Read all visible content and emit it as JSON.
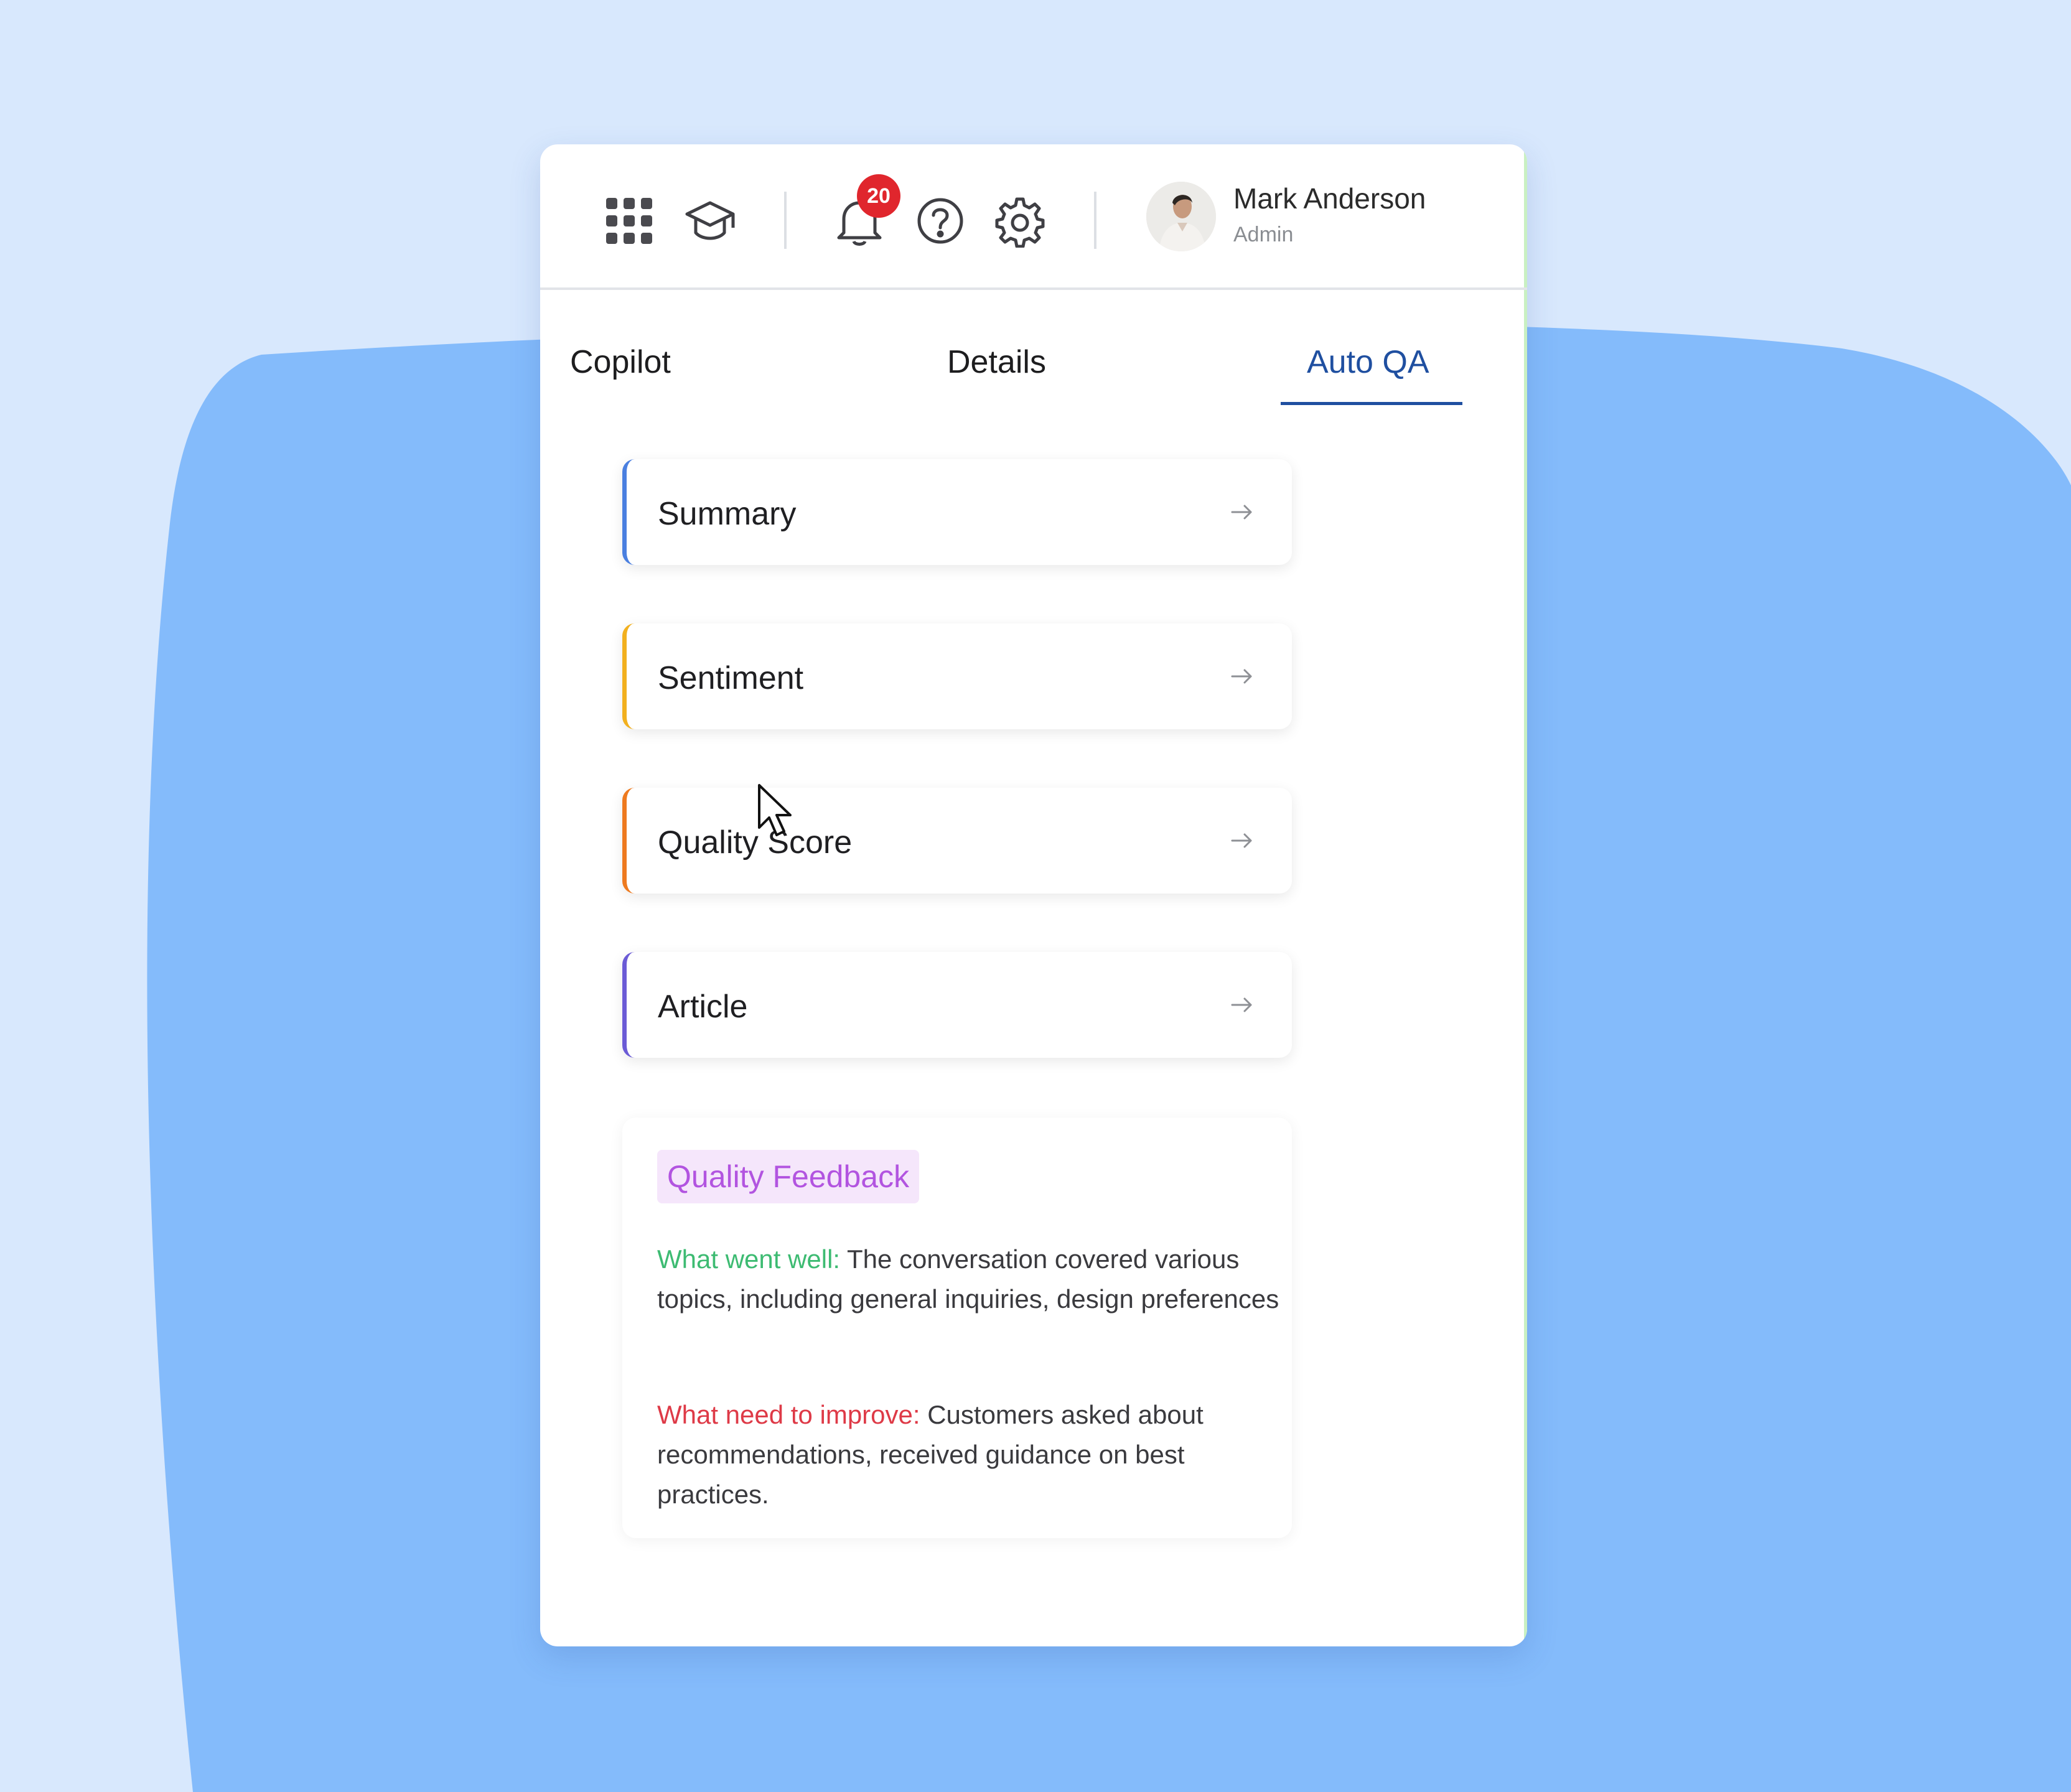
{
  "header": {
    "icons": [
      "apps-grid-icon",
      "graduation-cap-icon",
      "bell-icon",
      "help-icon",
      "gear-icon"
    ],
    "notification_count": "20",
    "user": {
      "name": "Mark Anderson",
      "role": "Admin"
    }
  },
  "tabs": [
    {
      "label": "Copilot",
      "active": false
    },
    {
      "label": "Details",
      "active": false
    },
    {
      "label": "Auto QA",
      "active": true
    }
  ],
  "cards": [
    {
      "label": "Summary",
      "accent": "#4a7fe0"
    },
    {
      "label": "Sentiment",
      "accent": "#f2b01e"
    },
    {
      "label": "Quality Score",
      "accent": "#ee7a1f"
    },
    {
      "label": "Article",
      "accent": "#6b5bd6"
    }
  ],
  "feedback": {
    "title": "Quality Feedback",
    "good_label": "What went well:",
    "good_text": " The conversation covered various topics, including general inquiries, design preferences",
    "bad_label": "What need to improve:",
    "bad_text": "  Customers asked about recommendations, received guidance on best practices."
  },
  "colors": {
    "active_tab": "#1f4fa0",
    "badge": "#e0262d",
    "feedback_title": "#b254e0",
    "good": "#3dbb72",
    "bad": "#de3a47"
  }
}
